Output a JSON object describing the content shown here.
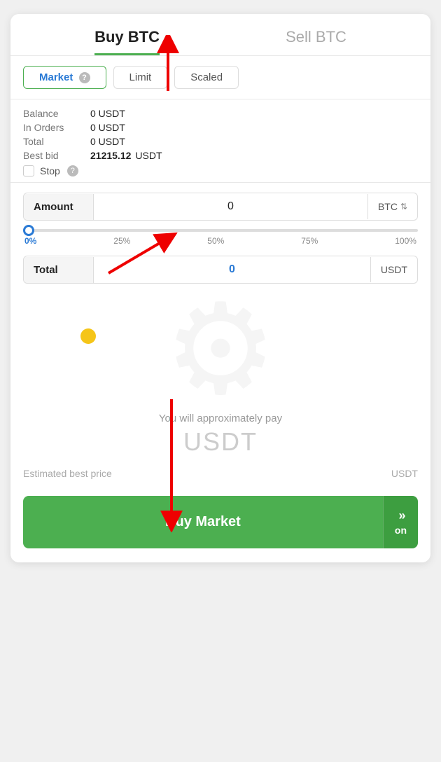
{
  "header": {
    "buy_label": "Buy BTC",
    "sell_label": "Sell BTC"
  },
  "order_types": [
    {
      "id": "market",
      "label": "Market",
      "active": true,
      "has_help": true
    },
    {
      "id": "limit",
      "label": "Limit",
      "active": false,
      "has_help": false
    },
    {
      "id": "scaled",
      "label": "Scaled",
      "active": false,
      "has_help": false
    }
  ],
  "info": {
    "balance_label": "Balance",
    "balance_value": "0 USDT",
    "in_orders_label": "In Orders",
    "in_orders_value": "0 USDT",
    "total_label": "Total",
    "total_value": "0 USDT",
    "best_bid_label": "Best bid",
    "best_bid_value": "21215.12",
    "best_bid_currency": "USDT",
    "stop_label": "Stop"
  },
  "amount_field": {
    "label": "Amount",
    "value": "0",
    "currency": "BTC"
  },
  "slider": {
    "value": 0,
    "percentages": [
      "0%",
      "25%",
      "50%",
      "75%",
      "100%"
    ]
  },
  "total_field": {
    "label": "Total",
    "value": "0",
    "currency": "USDT"
  },
  "pay_info": {
    "text": "You will approximately pay",
    "amount": "USDT"
  },
  "estimated": {
    "label": "Estimated best price",
    "currency": "USDT"
  },
  "buy_button": {
    "label": "Buy Market",
    "fast_label": "on"
  }
}
